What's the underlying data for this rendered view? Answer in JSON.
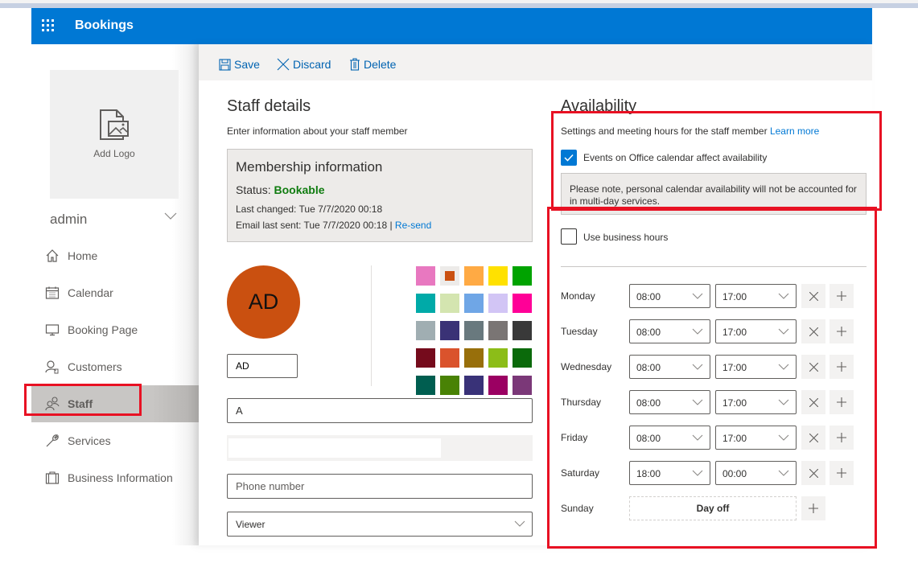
{
  "app": {
    "title": "Bookings",
    "waffle_icon": "app-launcher-icon"
  },
  "toolbar": {
    "save_label": "Save",
    "discard_label": "Discard",
    "delete_label": "Delete"
  },
  "sidebar": {
    "logo_label": "Add Logo",
    "account_name": "admin",
    "items": [
      {
        "label": "Home",
        "icon": "home-icon"
      },
      {
        "label": "Calendar",
        "icon": "calendar-icon"
      },
      {
        "label": "Booking Page",
        "icon": "monitor-icon"
      },
      {
        "label": "Customers",
        "icon": "customers-icon"
      },
      {
        "label": "Staff",
        "icon": "staff-icon",
        "active": true
      },
      {
        "label": "Services",
        "icon": "wrench-icon"
      },
      {
        "label": "Business Information",
        "icon": "briefcase-icon"
      }
    ]
  },
  "staff_details": {
    "title": "Staff details",
    "subtitle": "Enter information about your staff member",
    "membership": {
      "title": "Membership information",
      "status_label": "Status:",
      "status_value": "Bookable",
      "last_changed": "Last changed: Tue 7/7/2020 00:18",
      "email_last_sent": "Email last sent: Tue 7/7/2020 00:18 |",
      "resend_label": "Re-send"
    },
    "avatar_initials": "AD",
    "initials_value": "AD",
    "selected_color": "#ca5010",
    "colors": [
      "#e878c0",
      "#ca5010",
      "#ffaa44",
      "#ffe100",
      "#00a300",
      "#00aaa8",
      "#d4e5b0",
      "#6fa6e6",
      "#d2c5f5",
      "#ff0097",
      "#a0aeb2",
      "#3a3276",
      "#69797e",
      "#7a7574",
      "#393939",
      "#750b1c",
      "#da532c",
      "#986f0b",
      "#8cbd18",
      "#0b6a0b",
      "#005e50",
      "#498205",
      "#393278",
      "#9b0062",
      "#7b3878"
    ],
    "name_value": "A",
    "phone_placeholder": "Phone number",
    "role_value": "Viewer"
  },
  "availability": {
    "title": "Availability",
    "subtitle": "Settings and meeting hours for the staff member",
    "learn_more": "Learn more",
    "office_calendar_label": "Events on Office calendar affect availability",
    "office_calendar_checked": true,
    "note": "Please note, personal calendar availability will not be accounted for in multi-day services.",
    "business_hours_label": "Use business hours",
    "business_hours_checked": false,
    "days": [
      {
        "name": "Monday",
        "start": "08:00",
        "end": "17:00"
      },
      {
        "name": "Tuesday",
        "start": "08:00",
        "end": "17:00"
      },
      {
        "name": "Wednesday",
        "start": "08:00",
        "end": "17:00"
      },
      {
        "name": "Thursday",
        "start": "08:00",
        "end": "17:00"
      },
      {
        "name": "Friday",
        "start": "08:00",
        "end": "17:00"
      },
      {
        "name": "Saturday",
        "start": "18:00",
        "end": "00:00"
      },
      {
        "name": "Sunday",
        "day_off_label": "Day off"
      }
    ]
  }
}
